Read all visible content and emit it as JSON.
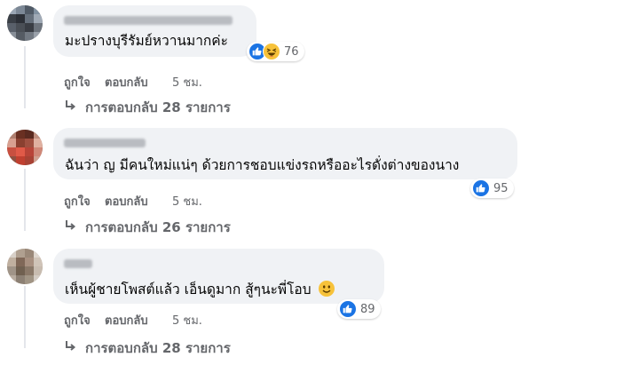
{
  "comments": [
    {
      "text": "มะปรางบุรีรัมย์หวานมากค่ะ",
      "reaction_count": "76",
      "reactions": [
        "like-icon",
        "haha-icon"
      ],
      "action_like": "ถูกใจ",
      "action_reply": "ตอบกลับ",
      "time": "5 ชม.",
      "replies": "การตอบกลับ 28 รายการ"
    },
    {
      "text": "ฉันว่า ญ มีคนใหม่แน่ๆ ด้วยการชอบแข่งรถหรืออะไรดั่งต่างของนาง",
      "reaction_count": "95",
      "reactions": [
        "like-icon"
      ],
      "action_like": "ถูกใจ",
      "action_reply": "ตอบกลับ",
      "time": "5 ชม.",
      "replies": "การตอบกลับ 26 รายการ"
    },
    {
      "text": "เห็นผู้ชายโพสต์แล้ว เอ็นดูมาก สู้ๆนะพี่โอบ",
      "text_emoji": "smiling-face-icon",
      "reaction_count": "89",
      "reactions": [
        "like-icon"
      ],
      "action_like": "ถูกใจ",
      "action_reply": "ตอบกลับ",
      "time": "5 ชม.",
      "replies": "การตอบกลับ 28 รายการ"
    }
  ],
  "colors": {
    "bubble": "#f0f2f5",
    "secondary_text": "#65676b",
    "like_blue": "#1b74e4",
    "haha_yellow": "#f7c23a"
  }
}
